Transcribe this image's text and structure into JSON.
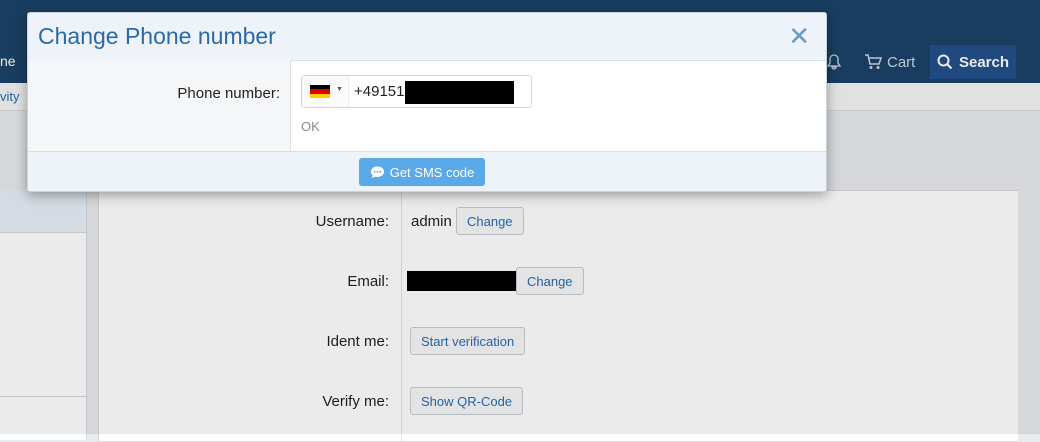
{
  "background": {
    "nav_partial_left": "ne",
    "subnav_partial": "vity",
    "bell_icon": "bell-icon",
    "cart_label": "Cart",
    "search_label": "Search",
    "cart_icon": "cart-icon",
    "search_icon": "search-icon",
    "rows": [
      {
        "label": "Username:",
        "value": "admin",
        "button": "Change"
      },
      {
        "label": "Email:",
        "value": "",
        "button": "Change"
      },
      {
        "label": "Ident me:",
        "button": "Start verification"
      },
      {
        "label": "Verify me:",
        "button": "Show QR-Code"
      }
    ]
  },
  "modal": {
    "title": "Change Phone number",
    "close_icon": "close-icon",
    "phone_label": "Phone number:",
    "country_flag": "germany-flag-icon",
    "phone_prefix": "+49151",
    "status_text": "OK",
    "submit_label": "Get SMS code",
    "submit_icon": "chat-bubble-icon"
  },
  "colors": {
    "header_blue": "#1b4369",
    "accent_blue": "#2b6aa8",
    "button_blue": "#5aa9e8"
  }
}
